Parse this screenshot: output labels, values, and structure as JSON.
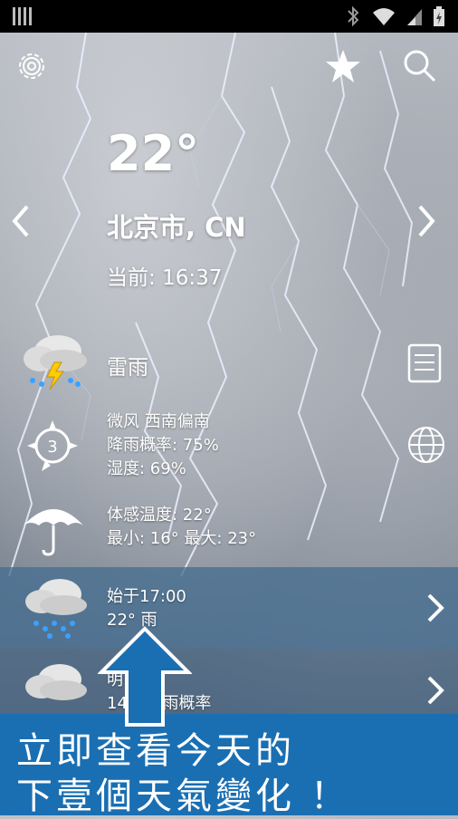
{
  "status_bar": {
    "icons": [
      "signal-bars-icon",
      "bluetooth-icon",
      "wifi-icon",
      "cell-signal-icon",
      "battery-charging-icon"
    ]
  },
  "toolbar": {
    "settings_icon": "gear-icon",
    "favorite_icon": "star-icon",
    "search_icon": "search-icon"
  },
  "current": {
    "temperature": "22°",
    "city": "北京市, CN",
    "updated": "当前: 16:37",
    "condition": "雷雨"
  },
  "details": {
    "wind": "微风 西南偏南",
    "wind_level": "3",
    "precip": "降雨概率: 75%",
    "humidity": "湿度: 69%",
    "feels_like": "体感温度: 22°",
    "min_max": "最小: 16° 最大: 23°"
  },
  "forecast": [
    {
      "title": "始于17:00",
      "subtitle": "22° 雨"
    },
    {
      "title": "明",
      "subtitle": "14 ° 降雨概率"
    }
  ],
  "promo": {
    "line1": "立即查看今天的",
    "line2": "下壹個天氣變化 ！"
  },
  "colors": {
    "promo_background": "#1a6fb3",
    "forecast_row": "#466e91"
  }
}
